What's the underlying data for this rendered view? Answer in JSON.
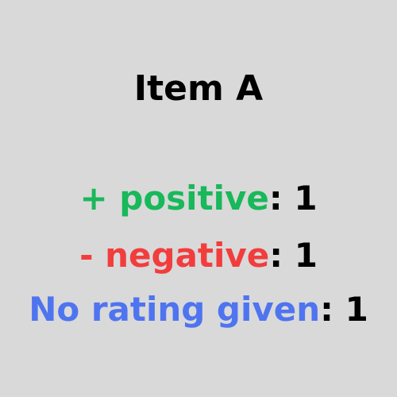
{
  "title": "Item A",
  "ratings": [
    {
      "label": "+ positive",
      "separator": ":",
      "count": "1",
      "color": "#19b85a"
    },
    {
      "label": "- negative",
      "separator": ":",
      "count": "1",
      "color": "#f23d3d"
    },
    {
      "label": "No rating given",
      "separator": ":",
      "count": "1",
      "color": "#4f74f0"
    }
  ]
}
